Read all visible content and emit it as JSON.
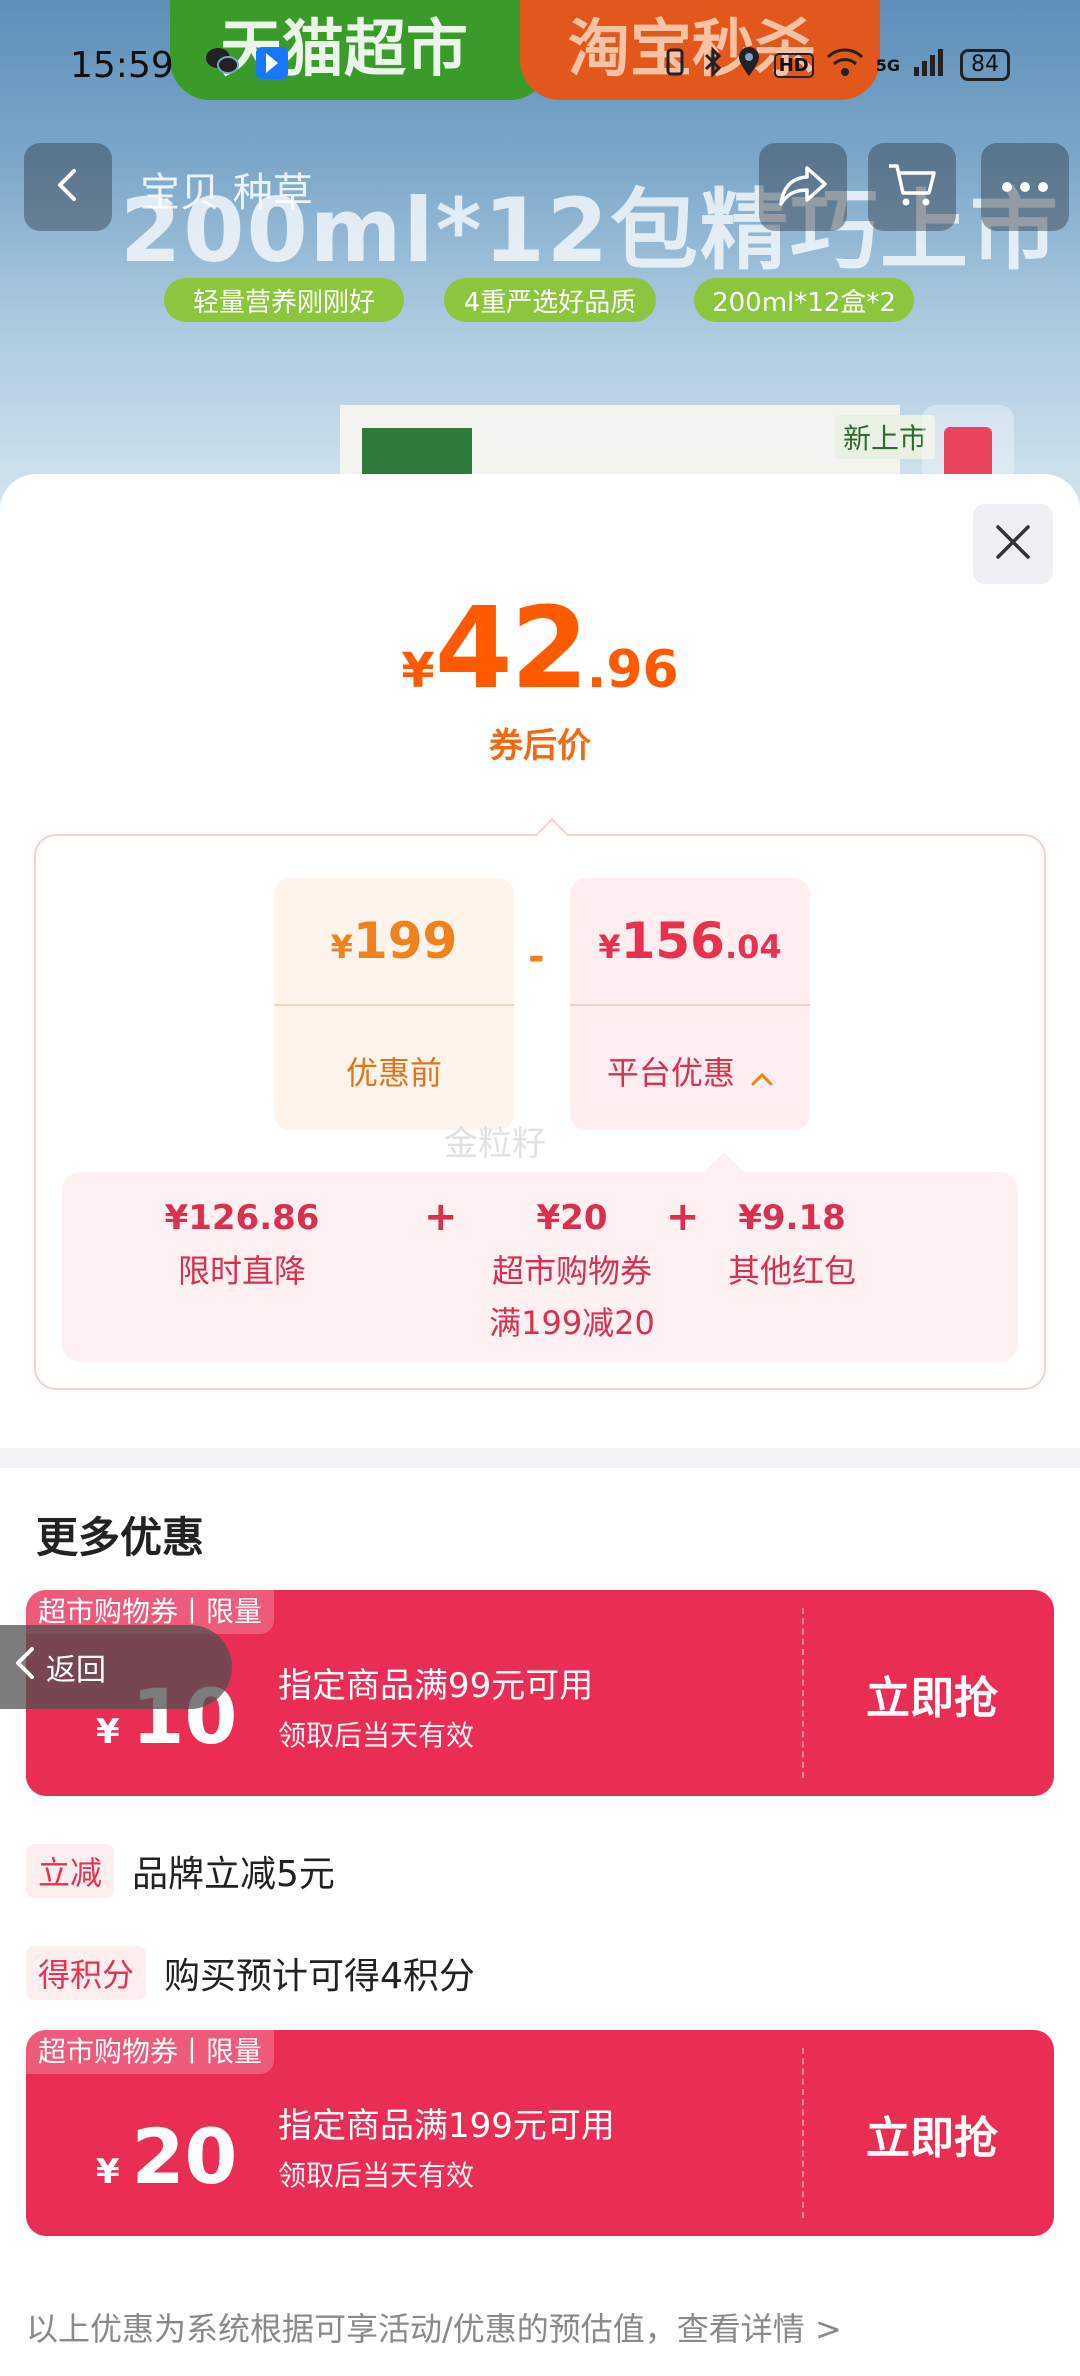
{
  "status_bar": {
    "time": "15:59",
    "battery": "84",
    "network": "5G",
    "hd": "HD"
  },
  "background": {
    "banner_left": "天猫超市",
    "banner_right": "淘宝秒杀",
    "headline": "200ml*12包精巧上市",
    "nav_overlay_text": "宝贝  种草",
    "chips": [
      "轻量营养刚刚好",
      "4重严选好品质",
      "200ml*12盒*2"
    ],
    "new_badge": "新上市"
  },
  "price_sheet": {
    "yen": "¥",
    "final_int": "42",
    "final_dec": ".96",
    "final_caption": "券后价",
    "before": {
      "yen": "¥",
      "int": "199",
      "label": "优惠前"
    },
    "minus": "-",
    "platform": {
      "yen": "¥",
      "int": "156",
      "dec": ".04",
      "label": "平台优惠"
    },
    "watermark": "金粒籽",
    "breakdown": [
      {
        "amount": "¥126.86",
        "label": "限时直降",
        "sub": ""
      },
      {
        "amount": "¥20",
        "label": "超市购物券",
        "sub": "满199减20"
      },
      {
        "amount": "¥9.18",
        "label": "其他红包",
        "sub": ""
      }
    ],
    "plus": "+"
  },
  "more_offers": {
    "title": "更多优惠",
    "coupons": [
      {
        "tag": "超市购物券丨限量",
        "yen": "¥",
        "value": "10",
        "condition": "指定商品满99元可用",
        "validity": "领取后当天有效",
        "cta": "立即抢"
      },
      {
        "tag": "超市购物券丨限量",
        "yen": "¥",
        "value": "20",
        "condition": "指定商品满199元可用",
        "validity": "领取后当天有效",
        "cta": "立即抢"
      }
    ],
    "promos": [
      {
        "tag": "立减",
        "text": "品牌立减5元"
      },
      {
        "tag": "得积分",
        "text": "购买预计可得4积分"
      }
    ],
    "footer": "以上优惠为系统根据可享活动/优惠的预估值，查看详情 >"
  },
  "back_float": {
    "label": "返回"
  },
  "colors": {
    "accent_orange": "#ff5a00",
    "accent_red": "#ea2d55",
    "card_before_bg": "#fff4ec",
    "card_platform_bg": "#ffedf0"
  },
  "icons": [
    "back-icon",
    "share-icon",
    "cart-icon",
    "more-icon",
    "close-icon",
    "chevron-up-icon",
    "chevron-left-icon",
    "wechat-icon",
    "app-icon",
    "bluetooth-icon",
    "location-icon",
    "wifi-icon",
    "signal-icon"
  ]
}
